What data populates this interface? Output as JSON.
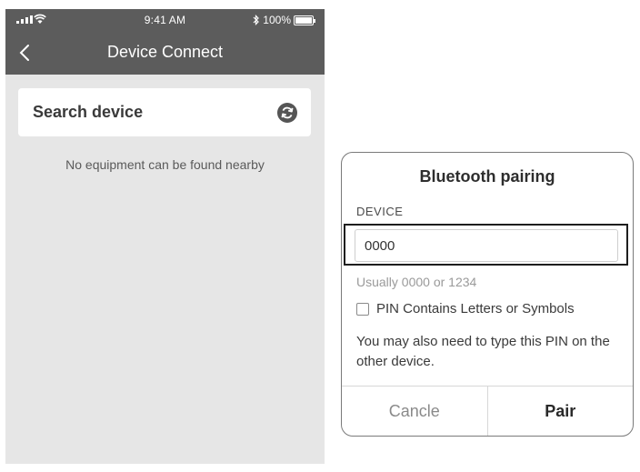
{
  "status_bar": {
    "time": "9:41 AM",
    "battery": "100%"
  },
  "nav": {
    "title": "Device Connect",
    "back_icon": "chevron-left-icon"
  },
  "search": {
    "label": "Search device",
    "refresh_icon": "refresh-icon"
  },
  "empty_message": "No equipment can be found nearby",
  "dialog": {
    "title": "Bluetooth pairing",
    "field_label": "DEVICE",
    "pin_value": "0000",
    "hint": "Usually 0000 or 1234",
    "checkbox_label": "PIN Contains Letters or Symbols",
    "checkbox_checked": false,
    "note": "You may also need to type this PIN on the other device.",
    "cancel_label": "Cancle",
    "pair_label": "Pair"
  },
  "colors": {
    "nav_bg": "#5c5c5c",
    "screen_bg": "#e6e6e6",
    "card_bg": "#ffffff"
  }
}
